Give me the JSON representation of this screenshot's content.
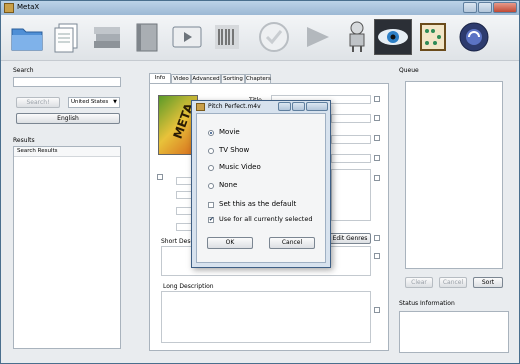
{
  "window": {
    "title": "MetaX"
  },
  "toolbar": {
    "buttons": [
      "folder-icon",
      "document-icon",
      "stack-icon",
      "book-icon",
      "media-player-icon",
      "barcode-icon",
      "checkmark-icon",
      "play-arrow-icon",
      "robot-icon",
      "eye-icon",
      "abacus-icon",
      "globe-icon"
    ]
  },
  "search": {
    "label": "Search",
    "query": "",
    "search_button": "Search!",
    "country": "United States",
    "language_button": "English"
  },
  "results": {
    "label": "Results",
    "header": "Search Results"
  },
  "tabs": [
    "Info",
    "Video",
    "Advanced",
    "Sorting",
    "Chapters"
  ],
  "info": {
    "artwork_text": "META",
    "title_label": "Title",
    "short_description_label": "Short Descri",
    "edit_genres_button": "Edit Genres",
    "long_description_label": "Long Description"
  },
  "queue": {
    "label": "Queue",
    "clear_button": "Clear",
    "cancel_button": "Cancel",
    "sort_button": "Sort"
  },
  "status": {
    "label": "Status Information"
  },
  "dialog": {
    "title": "Pitch Perfect.m4v",
    "options": [
      "Movie",
      "TV Show",
      "Music Video",
      "None"
    ],
    "selected": "Movie",
    "set_default_label": "Set this as the default",
    "set_default_checked": false,
    "use_all_label": "Use for all currently selected",
    "use_all_checked": true,
    "ok_button": "OK",
    "cancel_button": "Cancel"
  }
}
